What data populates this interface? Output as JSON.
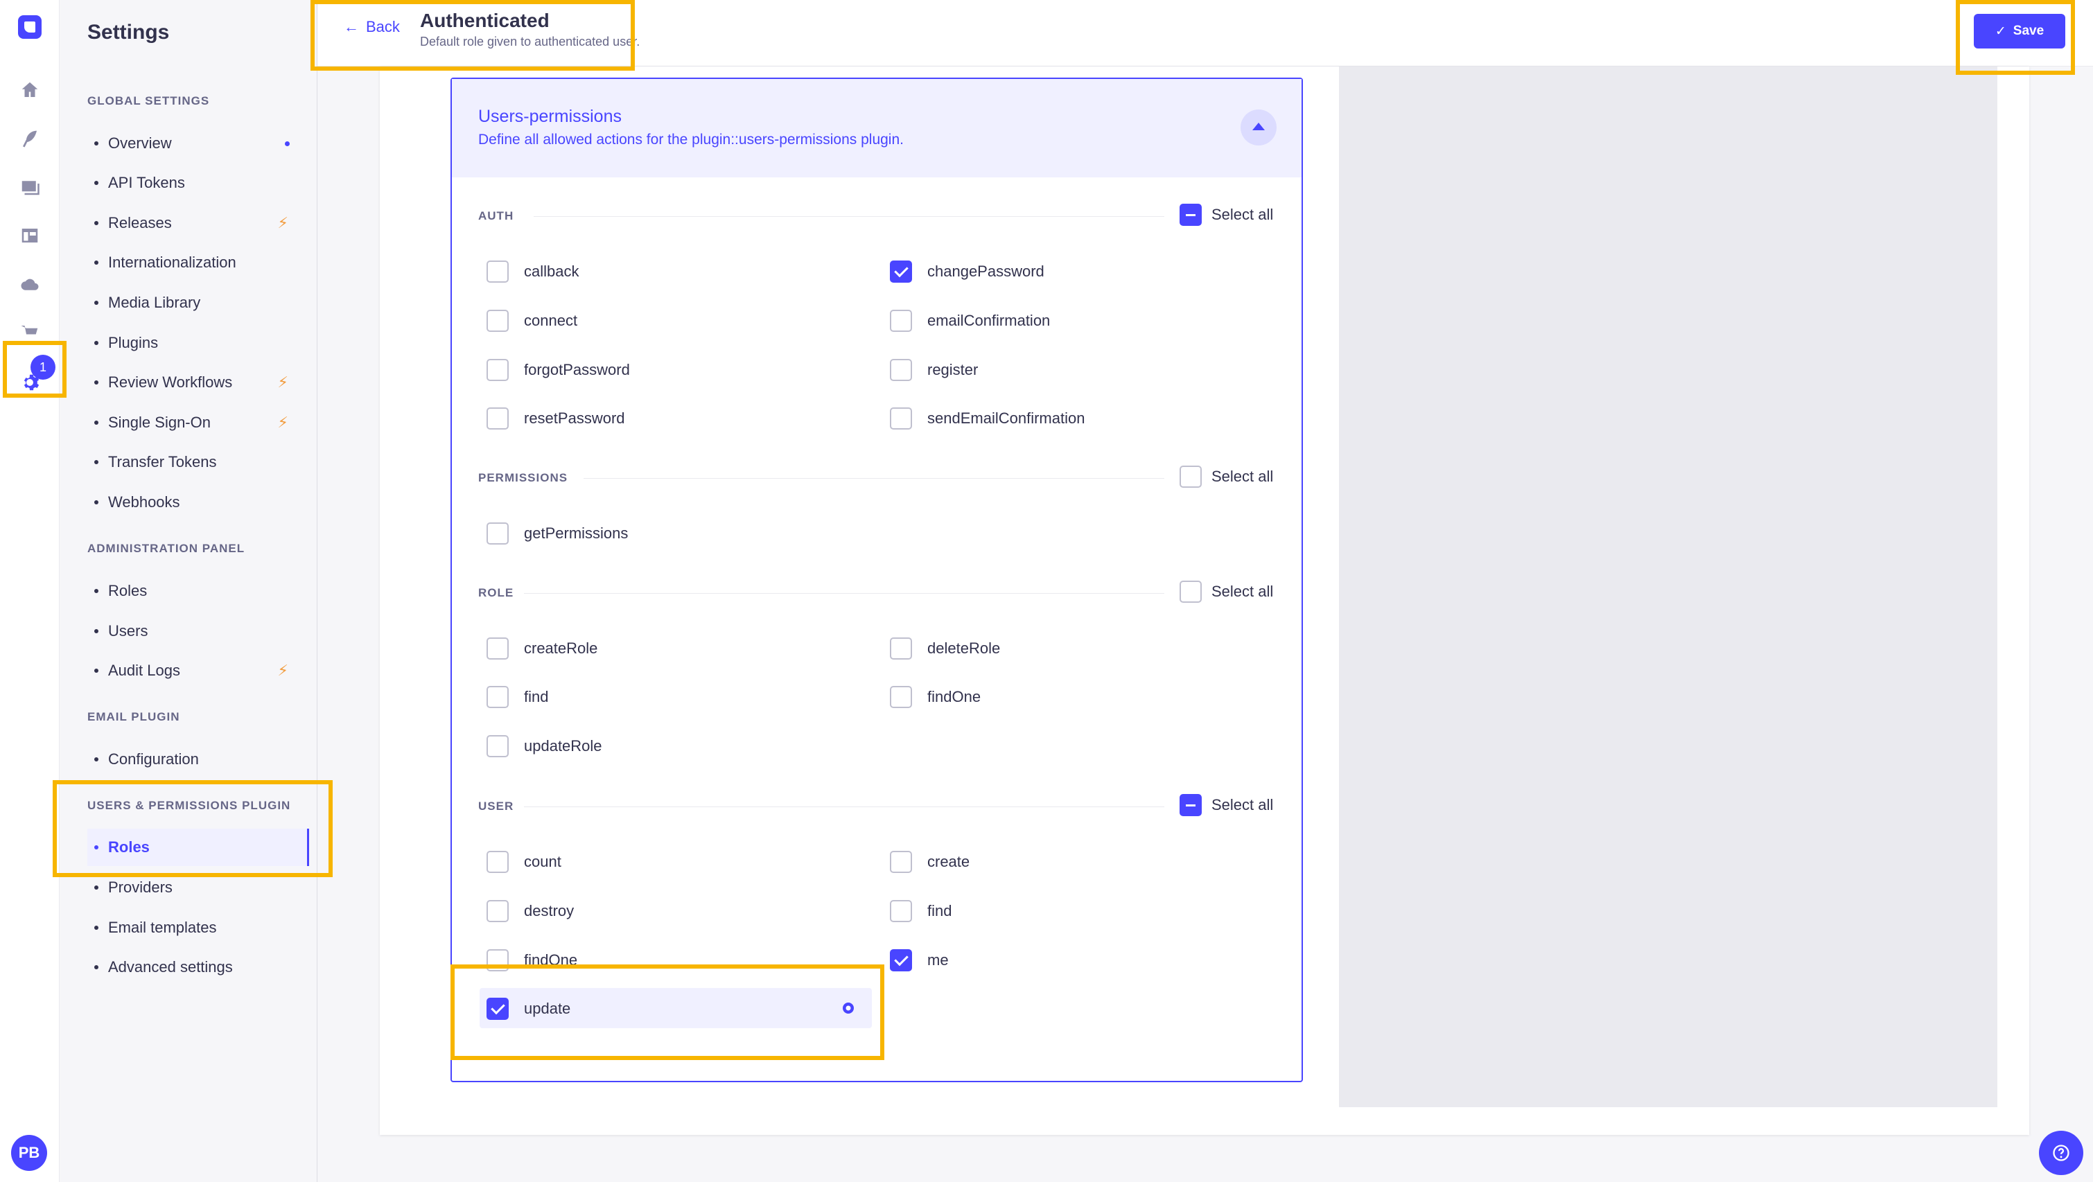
{
  "rail": {
    "badge": "1",
    "avatar": "PB"
  },
  "sidebar": {
    "title": "Settings",
    "sections": [
      {
        "label": "GLOBAL SETTINGS",
        "items": [
          "Overview",
          "API Tokens",
          "Releases",
          "Internationalization",
          "Media Library",
          "Plugins",
          "Review Workflows",
          "Single Sign-On",
          "Transfer Tokens",
          "Webhooks"
        ]
      },
      {
        "label": "ADMINISTRATION PANEL",
        "items": [
          "Roles",
          "Users",
          "Audit Logs"
        ]
      },
      {
        "label": "EMAIL PLUGIN",
        "items": [
          "Configuration"
        ]
      },
      {
        "label": "USERS & PERMISSIONS PLUGIN",
        "items": [
          "Roles",
          "Providers",
          "Email templates",
          "Advanced settings"
        ]
      }
    ]
  },
  "header": {
    "back_label": "Back",
    "title": "Authenticated",
    "subtitle": "Default role given to authenticated user.",
    "save_label": "Save"
  },
  "permissions": {
    "title": "Users-permissions",
    "description": "Define all allowed actions for the plugin::users-permissions plugin.",
    "select_all_label": "Select all",
    "groups": [
      {
        "label": "AUTH",
        "select_all": "indeterminate",
        "actions": [
          {
            "name": "callback",
            "checked": false
          },
          {
            "name": "changePassword",
            "checked": true
          },
          {
            "name": "connect",
            "checked": false
          },
          {
            "name": "emailConfirmation",
            "checked": false
          },
          {
            "name": "forgotPassword",
            "checked": false
          },
          {
            "name": "register",
            "checked": false
          },
          {
            "name": "resetPassword",
            "checked": false
          },
          {
            "name": "sendEmailConfirmation",
            "checked": false
          }
        ]
      },
      {
        "label": "PERMISSIONS",
        "select_all": "unchecked",
        "actions": [
          {
            "name": "getPermissions",
            "checked": false
          }
        ]
      },
      {
        "label": "ROLE",
        "select_all": "unchecked",
        "actions": [
          {
            "name": "createRole",
            "checked": false
          },
          {
            "name": "deleteRole",
            "checked": false
          },
          {
            "name": "find",
            "checked": false
          },
          {
            "name": "findOne",
            "checked": false
          },
          {
            "name": "updateRole",
            "checked": false
          }
        ]
      },
      {
        "label": "USER",
        "select_all": "indeterminate",
        "actions": [
          {
            "name": "count",
            "checked": false
          },
          {
            "name": "create",
            "checked": false
          },
          {
            "name": "destroy",
            "checked": false
          },
          {
            "name": "find",
            "checked": false
          },
          {
            "name": "findOne",
            "checked": false
          },
          {
            "name": "me",
            "checked": true
          },
          {
            "name": "update",
            "checked": true
          }
        ]
      }
    ]
  },
  "colors": {
    "primary": "#4945ff",
    "highlight": "#f7b500",
    "flag": "#f29d41"
  }
}
